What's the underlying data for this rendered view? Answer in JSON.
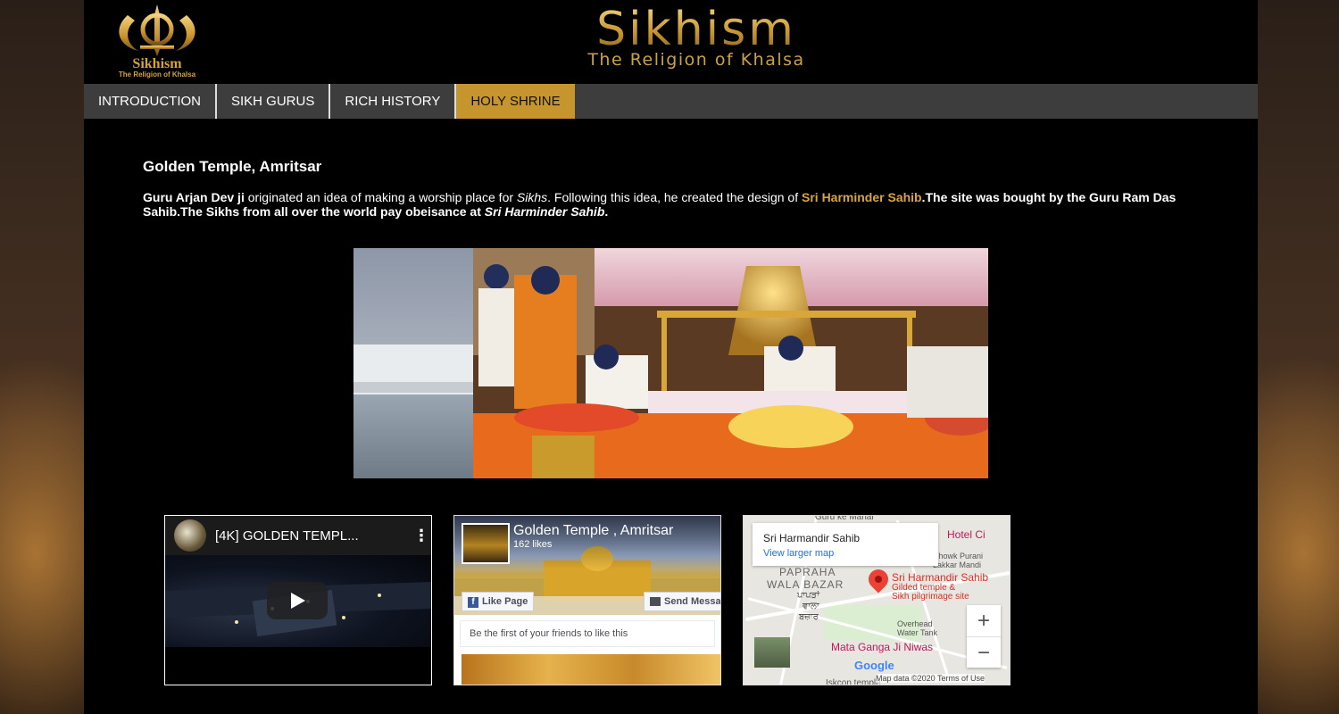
{
  "header": {
    "logo_title": "Sikhism",
    "logo_subtitle": "The Religion of Khalsa",
    "site_title": "Sikhism",
    "site_tagline": "The Religion of Khalsa"
  },
  "nav": {
    "items": [
      {
        "label": "INTRODUCTION"
      },
      {
        "label": "SIKH GURUS"
      },
      {
        "label": "RICH HISTORY"
      },
      {
        "label": "HOLY SHRINE",
        "active": true
      }
    ]
  },
  "content": {
    "heading": "Golden Temple, Amritsar",
    "p1_bold": "Guru Arjan Dev ji",
    "p1_text": " originated an idea of making a worship place for ",
    "p1_em": "Sikhs",
    "p1_text2": ". Following this idea, he created the design of ",
    "p1_gold": "Sri Harminder Sahib",
    "p1_bold2": ".The site was bought by the Guru Ram Das Sahib.The Sikhs from all over the world pay obeisance at ",
    "p1_em2": "Sri Harminder Sahib",
    "p1_end": "."
  },
  "youtube": {
    "title": "[4K] GOLDEN TEMPL..."
  },
  "facebook": {
    "page_name": "Golden Temple , Amritsar",
    "likes": "162 likes",
    "like_button": "Like Page",
    "send_button": "Send Message",
    "friends_text": "Be the first of your friends to like this"
  },
  "map": {
    "place_name": "Sri Harmandir Sahib",
    "larger_map_link": "View larger map",
    "labels": {
      "hotel": "Hotel Ci",
      "chowk": "Chowk Purani",
      "lakkar": "Lakkar Mandi",
      "papraha": "PAPRAHA",
      "wala": "WALA BAZAR",
      "punjabi1": "ਪਾਪੜਾਂ",
      "punjabi2": "ਵਾਲਾ",
      "punjabi3": "ਬਜ਼ਾਰ",
      "pin_name": "Sri Harmandir Sahib",
      "pin_desc1": "Gilded temple &",
      "pin_desc2": "Sikh pilgrimage site",
      "overhead1": "Overhead",
      "overhead2": "Water Tank",
      "mata": "Mata Ganga Ji Niwas",
      "iskcon": "Iskcon temple",
      "top": "Guru ke Mahal",
      "zoom_in": "+",
      "zoom_out": "−",
      "google": "Google",
      "footer": "Map data ©2020   Terms of Use"
    }
  }
}
